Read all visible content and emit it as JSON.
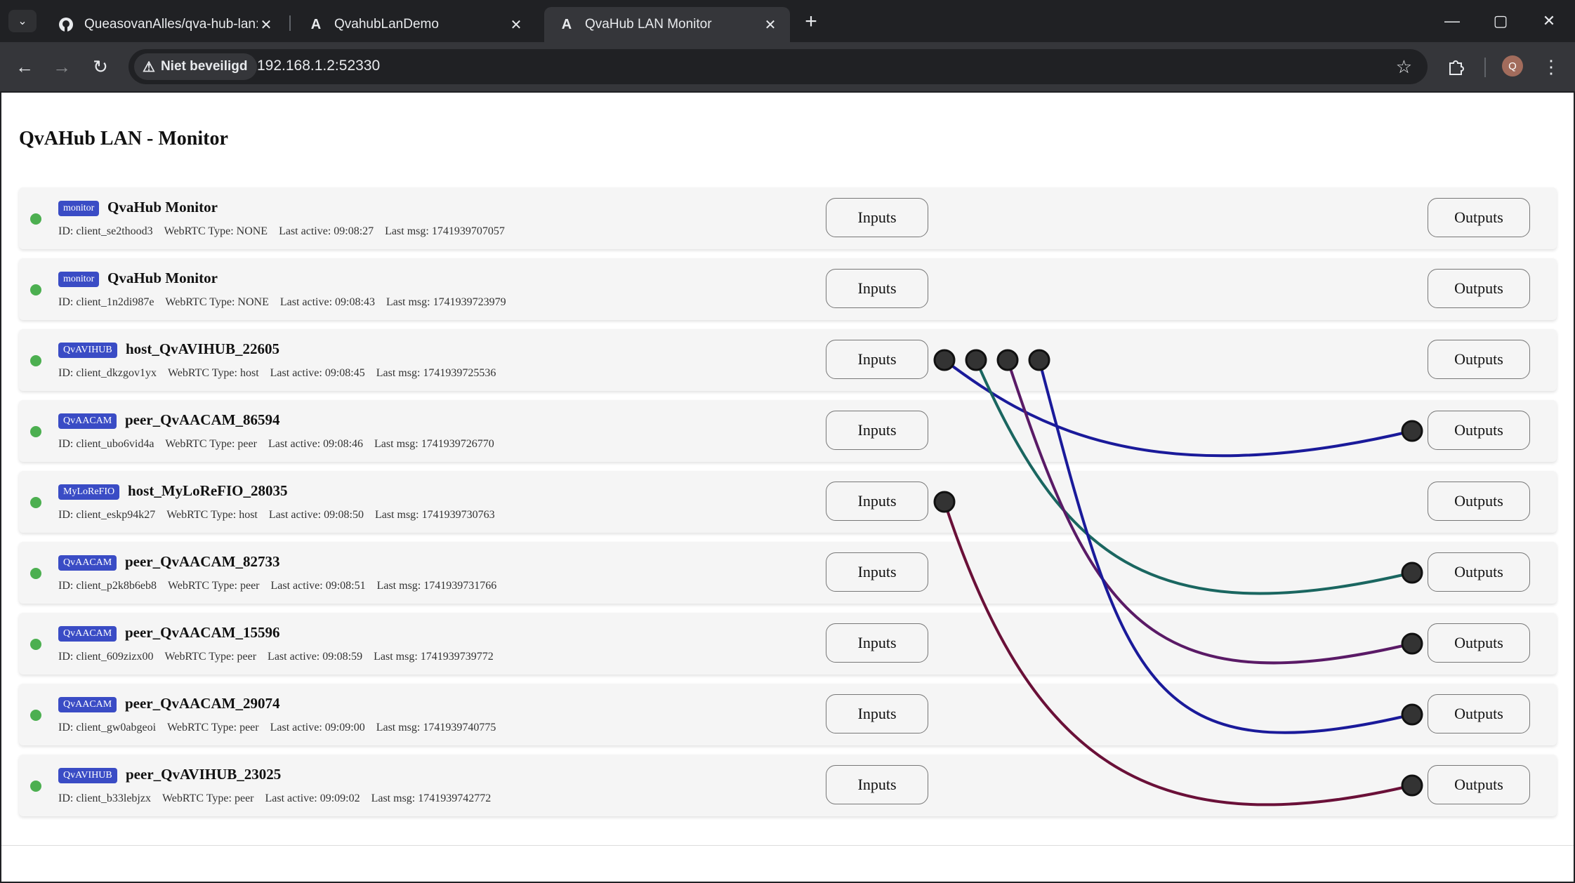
{
  "browser": {
    "tabs": [
      {
        "title": "QueasovanAlles/qva-hub-lan: W",
        "icon": "github-icon",
        "active": false
      },
      {
        "title": "QvahubLanDemo",
        "icon": "angular-icon",
        "active": false
      },
      {
        "title": "QvaHub LAN Monitor",
        "icon": "angular-icon",
        "active": true
      }
    ],
    "security_label": "Niet beveiligd",
    "url": "192.168.1.2:52330",
    "profile_initial": "Q"
  },
  "page": {
    "title": "QvAHub LAN - Monitor",
    "inputs_label": "Inputs",
    "outputs_label": "Outputs",
    "id_prefix": "ID:",
    "webrtc_prefix": "WebRTC Type:",
    "active_prefix": "Last active:",
    "msg_prefix": "Last msg:",
    "clients": [
      {
        "badge": "monitor",
        "name": "QvaHub Monitor",
        "id": "client_se2thood3",
        "webrtc": "NONE",
        "last_active": "09:08:27",
        "last_msg": "1741939707057",
        "status": "online"
      },
      {
        "badge": "monitor",
        "name": "QvaHub Monitor",
        "id": "client_1n2di987e",
        "webrtc": "NONE",
        "last_active": "09:08:43",
        "last_msg": "1741939723979",
        "status": "online"
      },
      {
        "badge": "QvAVIHUB",
        "name": "host_QvAVIHUB_22605",
        "id": "client_dkzgov1yx",
        "webrtc": "host",
        "last_active": "09:08:45",
        "last_msg": "1741939725536",
        "status": "online"
      },
      {
        "badge": "QvAACAM",
        "name": "peer_QvAACAM_86594",
        "id": "client_ubo6vid4a",
        "webrtc": "peer",
        "last_active": "09:08:46",
        "last_msg": "1741939726770",
        "status": "online"
      },
      {
        "badge": "MyLoReFIO",
        "name": "host_MyLoReFIO_28035",
        "id": "client_eskp94k27",
        "webrtc": "host",
        "last_active": "09:08:50",
        "last_msg": "1741939730763",
        "status": "online"
      },
      {
        "badge": "QvAACAM",
        "name": "peer_QvAACAM_82733",
        "id": "client_p2k8b6eb8",
        "webrtc": "peer",
        "last_active": "09:08:51",
        "last_msg": "1741939731766",
        "status": "online"
      },
      {
        "badge": "QvAACAM",
        "name": "peer_QvAACAM_15596",
        "id": "client_609zizx00",
        "webrtc": "peer",
        "last_active": "09:08:59",
        "last_msg": "1741939739772",
        "status": "online"
      },
      {
        "badge": "QvAACAM",
        "name": "peer_QvAACAM_29074",
        "id": "client_gw0abgeoi",
        "webrtc": "peer",
        "last_active": "09:09:00",
        "last_msg": "1741939740775",
        "status": "online"
      },
      {
        "badge": "QvAVIHUB",
        "name": "peer_QvAVIHUB_23025",
        "id": "client_b33lebjzx",
        "webrtc": "peer",
        "last_active": "09:09:02",
        "last_msg": "1741939742772",
        "status": "online"
      }
    ],
    "connections": [
      {
        "from_row": 2,
        "from_port": 0,
        "to_row": 3,
        "color": "#1a1a9a"
      },
      {
        "from_row": 2,
        "from_port": 1,
        "to_row": 5,
        "color": "#1a6660"
      },
      {
        "from_row": 2,
        "from_port": 2,
        "to_row": 6,
        "color": "#5a1a66"
      },
      {
        "from_row": 2,
        "from_port": 3,
        "to_row": 7,
        "color": "#1a1a9a"
      },
      {
        "from_row": 4,
        "from_port": 0,
        "to_row": 8,
        "color": "#6a1038"
      }
    ]
  },
  "colors": {
    "status_online": "#4caf50",
    "badge_bg": "#3a4cc5"
  }
}
